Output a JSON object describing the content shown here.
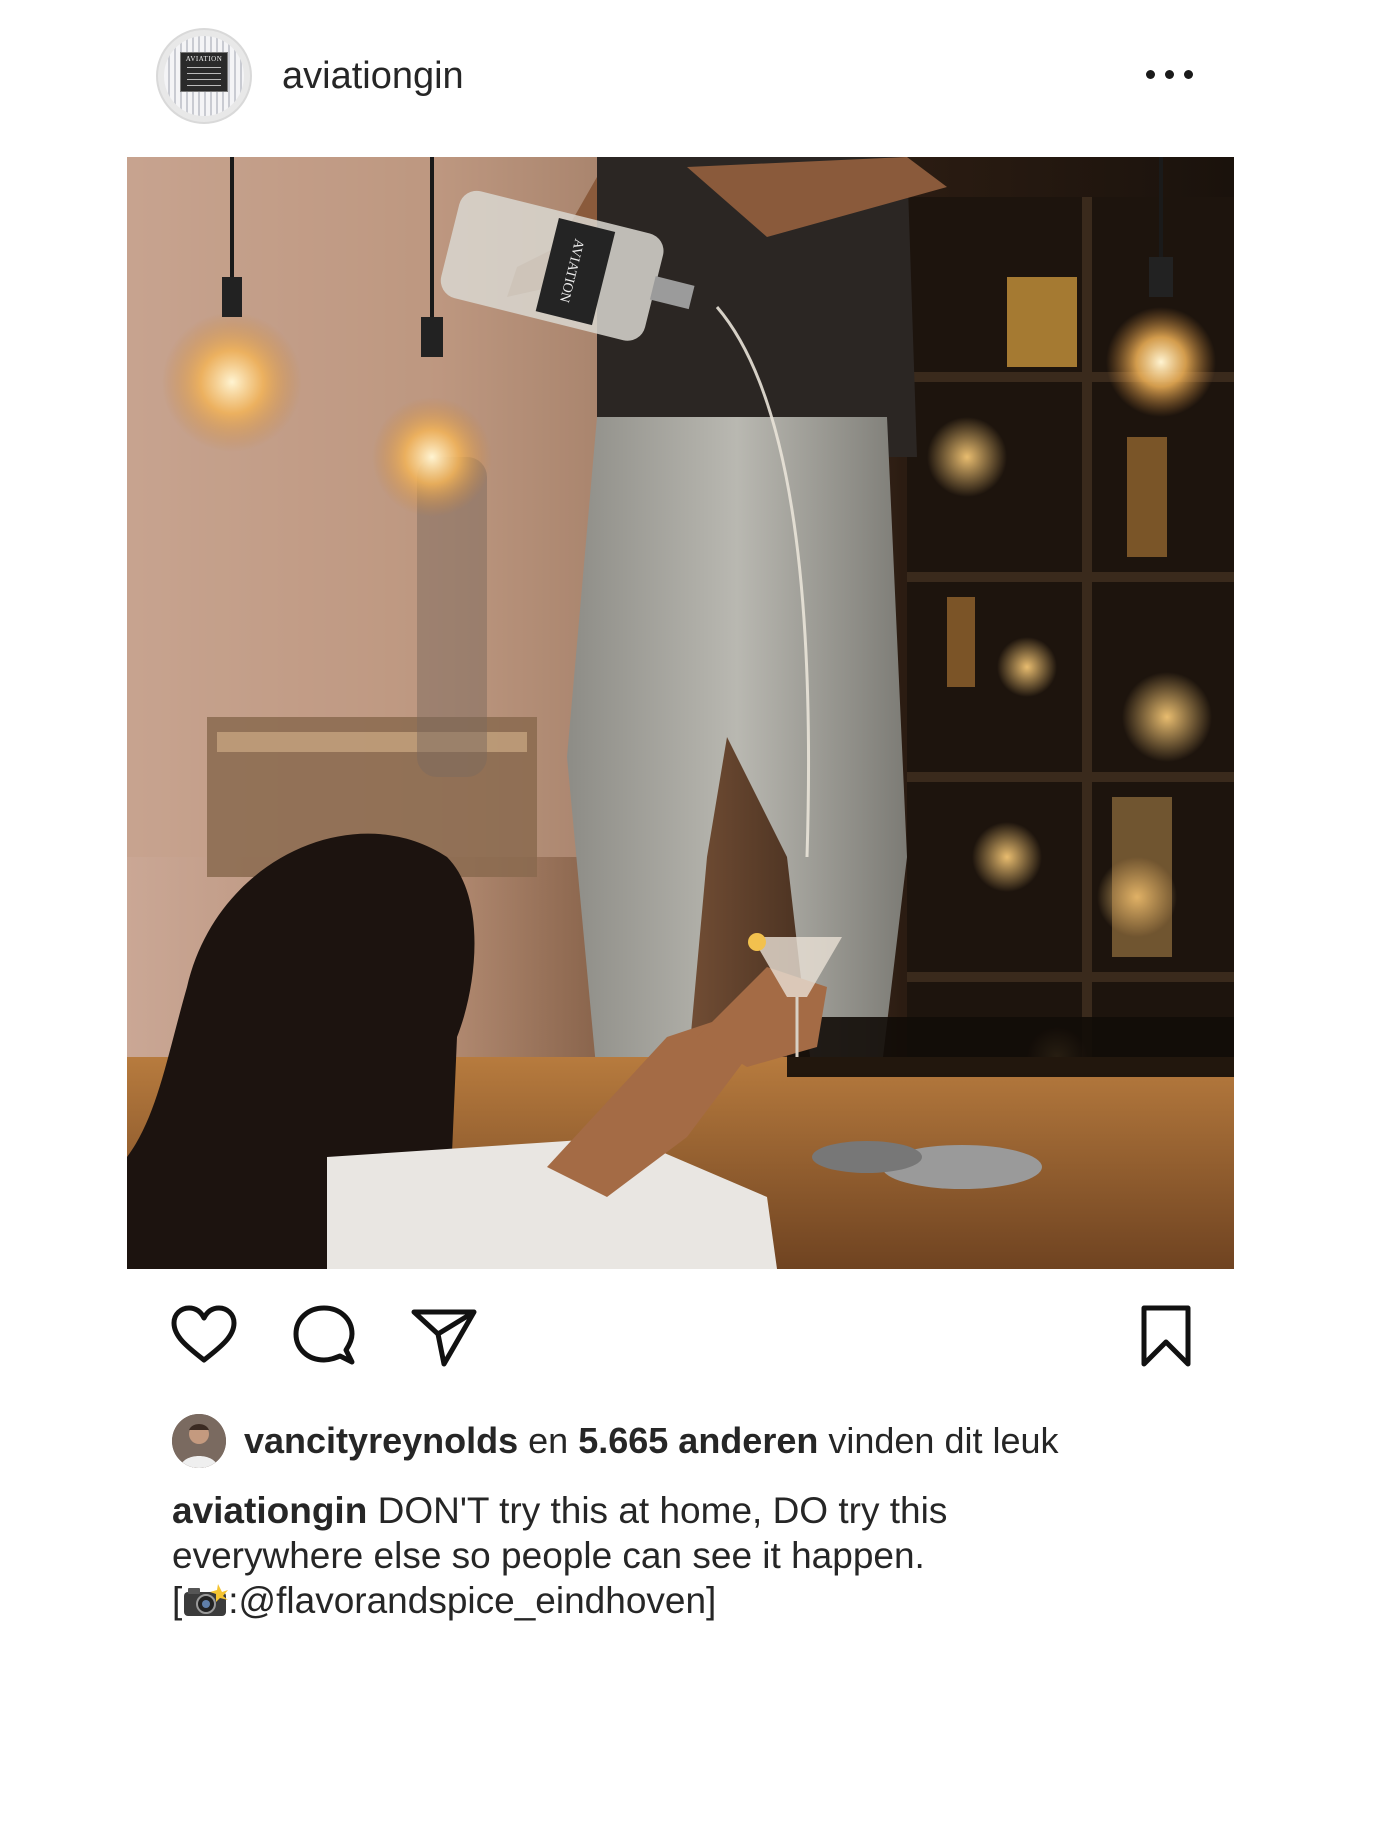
{
  "post": {
    "username": "aviationgin",
    "avatar_label": "AVIATION",
    "more_icon": "more-horizontal-icon"
  },
  "photo": {
    "bottle_label": "AVIATION"
  },
  "actions": {
    "like_icon": "heart-icon",
    "comment_icon": "comment-icon",
    "share_icon": "paper-plane-icon",
    "save_icon": "bookmark-icon"
  },
  "likes": {
    "first_liker": "vancityreynolds",
    "connector": "en",
    "others": "5.665 anderen",
    "suffix": "vinden dit leuk"
  },
  "caption": {
    "author": "aviationgin",
    "line1": "DON'T try this at home, DO try this",
    "line2": "everywhere else so people can see it happen.",
    "open_bracket": "[",
    "credit_emoji": "camera-with-flash-icon",
    "credit": ":@flavorandspice_eindhoven]"
  }
}
